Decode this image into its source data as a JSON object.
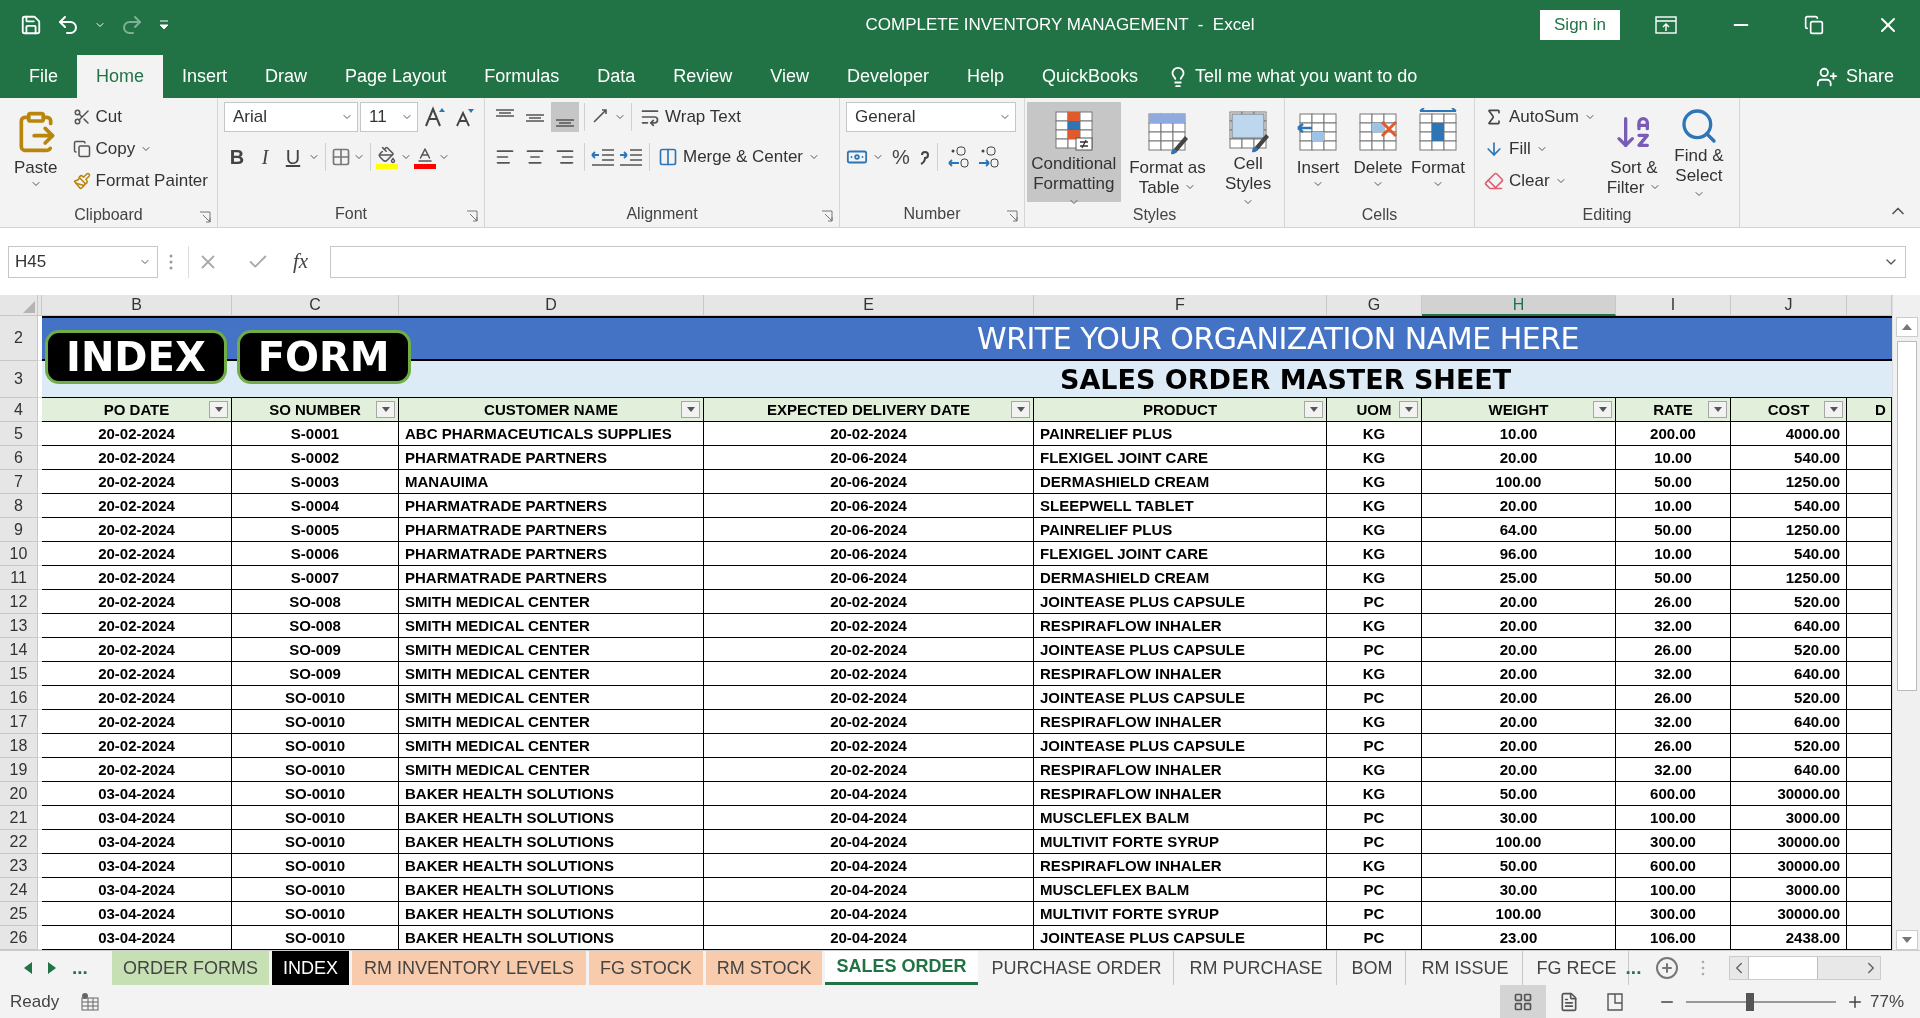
{
  "title_bar": {
    "title": "COMPLETE INVENTORY MANAGEMENT  -  Excel",
    "sign_in": "Sign in"
  },
  "menu": [
    {
      "label": "File",
      "selected": false
    },
    {
      "label": "Home",
      "selected": true
    },
    {
      "label": "Insert",
      "selected": false
    },
    {
      "label": "Draw",
      "selected": false
    },
    {
      "label": "Page Layout",
      "selected": false
    },
    {
      "label": "Formulas",
      "selected": false
    },
    {
      "label": "Data",
      "selected": false
    },
    {
      "label": "Review",
      "selected": false
    },
    {
      "label": "View",
      "selected": false
    },
    {
      "label": "Developer",
      "selected": false
    },
    {
      "label": "Help",
      "selected": false
    },
    {
      "label": "QuickBooks",
      "selected": false
    }
  ],
  "tell_me": "Tell me what you want to do",
  "share": "Share",
  "ribbon": {
    "clipboard": {
      "label": "Clipboard",
      "paste": "Paste",
      "cut": "Cut",
      "copy": "Copy",
      "format_painter": "Format Painter"
    },
    "font": {
      "label": "Font",
      "name": "Arial",
      "size": "11",
      "bold": "B",
      "italic": "I",
      "underline": "U"
    },
    "alignment": {
      "label": "Alignment",
      "vertical_align": [
        {
          "selected": false
        },
        {
          "selected": false
        },
        {
          "selected": true
        }
      ],
      "wrap_text": "Wrap Text",
      "merge_center": "Merge & Center"
    },
    "number": {
      "label": "Number",
      "format": "General",
      "percent": "%"
    },
    "styles": {
      "label": "Styles",
      "buttons": [
        {
          "label": "Conditional Formatting",
          "highlighted": true
        },
        {
          "label": "Format as Table",
          "highlighted": false
        },
        {
          "label": "Cell Styles",
          "highlighted": false
        }
      ]
    },
    "cells": {
      "label": "Cells",
      "buttons": [
        "Insert",
        "Delete",
        "Format"
      ]
    },
    "editing": {
      "label": "Editing",
      "autosum": "AutoSum",
      "fill": "Fill",
      "clear": "Clear",
      "sort_filter": "Sort & Filter",
      "find_select": "Find & Select"
    }
  },
  "formula_bar": {
    "name_box": "H45",
    "fx": "fx"
  },
  "column_headers": [
    {
      "label": "B",
      "selected": false
    },
    {
      "label": "C",
      "selected": false
    },
    {
      "label": "D",
      "selected": false
    },
    {
      "label": "E",
      "selected": false
    },
    {
      "label": "F",
      "selected": false
    },
    {
      "label": "G",
      "selected": false
    },
    {
      "label": "H",
      "selected": true
    },
    {
      "label": "I",
      "selected": false
    },
    {
      "label": "J",
      "selected": false
    }
  ],
  "sheet": {
    "banner_rows": [
      "2",
      "3"
    ],
    "nav_buttons": [
      "INDEX",
      "FORM"
    ],
    "org_name": "WRITE YOUR ORGANIZATION NAME HERE",
    "title": "SALES ORDER MASTER SHEET",
    "header_row": "4",
    "columns": [
      "PO DATE",
      "SO NUMBER",
      "CUSTOMER NAME",
      "EXPECTED DELIVERY DATE",
      "PRODUCT",
      "UOM",
      "WEIGHT",
      "RATE",
      "COST",
      "D"
    ],
    "rows": [
      {
        "n": "5",
        "cells": [
          "20-02-2024",
          "S-0001",
          "ABC PHARMACEUTICALS SUPPLIES",
          "20-02-2024",
          "PAINRELIEF PLUS",
          "KG",
          "10.00",
          "200.00",
          "4000.00"
        ]
      },
      {
        "n": "6",
        "cells": [
          "20-02-2024",
          "S-0002",
          "PHARMATRADE PARTNERS",
          "20-06-2024",
          "FLEXIGEL JOINT CARE",
          "KG",
          "20.00",
          "10.00",
          "540.00"
        ]
      },
      {
        "n": "7",
        "cells": [
          "20-02-2024",
          "S-0003",
          "MANAUIMA",
          "20-06-2024",
          "DERMASHIELD CREAM",
          "KG",
          "100.00",
          "50.00",
          "1250.00"
        ]
      },
      {
        "n": "8",
        "cells": [
          "20-02-2024",
          "S-0004",
          "PHARMATRADE PARTNERS",
          "20-06-2024",
          "SLEEPWELL TABLET",
          "KG",
          "20.00",
          "10.00",
          "540.00"
        ]
      },
      {
        "n": "9",
        "cells": [
          "20-02-2024",
          "S-0005",
          "PHARMATRADE PARTNERS",
          "20-06-2024",
          "PAINRELIEF PLUS",
          "KG",
          "64.00",
          "50.00",
          "1250.00"
        ]
      },
      {
        "n": "10",
        "cells": [
          "20-02-2024",
          "S-0006",
          "PHARMATRADE PARTNERS",
          "20-06-2024",
          "FLEXIGEL JOINT CARE",
          "KG",
          "96.00",
          "10.00",
          "540.00"
        ]
      },
      {
        "n": "11",
        "cells": [
          "20-02-2024",
          "S-0007",
          "PHARMATRADE PARTNERS",
          "20-06-2024",
          "DERMASHIELD CREAM",
          "KG",
          "25.00",
          "50.00",
          "1250.00"
        ]
      },
      {
        "n": "12",
        "cells": [
          "20-02-2024",
          "SO-008",
          "SMITH MEDICAL CENTER",
          "20-02-2024",
          "JOINTEASE PLUS CAPSULE",
          "PC",
          "20.00",
          "26.00",
          "520.00"
        ]
      },
      {
        "n": "13",
        "cells": [
          "20-02-2024",
          "SO-008",
          "SMITH MEDICAL CENTER",
          "20-02-2024",
          "RESPIRAFLOW INHALER",
          "KG",
          "20.00",
          "32.00",
          "640.00"
        ]
      },
      {
        "n": "14",
        "cells": [
          "20-02-2024",
          "SO-009",
          "SMITH MEDICAL CENTER",
          "20-02-2024",
          "JOINTEASE PLUS CAPSULE",
          "PC",
          "20.00",
          "26.00",
          "520.00"
        ]
      },
      {
        "n": "15",
        "cells": [
          "20-02-2024",
          "SO-009",
          "SMITH MEDICAL CENTER",
          "20-02-2024",
          "RESPIRAFLOW INHALER",
          "KG",
          "20.00",
          "32.00",
          "640.00"
        ]
      },
      {
        "n": "16",
        "cells": [
          "20-02-2024",
          "SO-0010",
          "SMITH MEDICAL CENTER",
          "20-02-2024",
          "JOINTEASE PLUS CAPSULE",
          "PC",
          "20.00",
          "26.00",
          "520.00"
        ]
      },
      {
        "n": "17",
        "cells": [
          "20-02-2024",
          "SO-0010",
          "SMITH MEDICAL CENTER",
          "20-02-2024",
          "RESPIRAFLOW INHALER",
          "KG",
          "20.00",
          "32.00",
          "640.00"
        ]
      },
      {
        "n": "18",
        "cells": [
          "20-02-2024",
          "SO-0010",
          "SMITH MEDICAL CENTER",
          "20-02-2024",
          "JOINTEASE PLUS CAPSULE",
          "PC",
          "20.00",
          "26.00",
          "520.00"
        ]
      },
      {
        "n": "19",
        "cells": [
          "20-02-2024",
          "SO-0010",
          "SMITH MEDICAL CENTER",
          "20-02-2024",
          "RESPIRAFLOW INHALER",
          "KG",
          "20.00",
          "32.00",
          "640.00"
        ]
      },
      {
        "n": "20",
        "cells": [
          "03-04-2024",
          "SO-0010",
          "BAKER HEALTH SOLUTIONS",
          "20-04-2024",
          "RESPIRAFLOW INHALER",
          "KG",
          "50.00",
          "600.00",
          "30000.00"
        ]
      },
      {
        "n": "21",
        "cells": [
          "03-04-2024",
          "SO-0010",
          "BAKER HEALTH SOLUTIONS",
          "20-04-2024",
          "MUSCLEFLEX BALM",
          "PC",
          "30.00",
          "100.00",
          "3000.00"
        ]
      },
      {
        "n": "22",
        "cells": [
          "03-04-2024",
          "SO-0010",
          "BAKER HEALTH SOLUTIONS",
          "20-04-2024",
          "MULTIVIT FORTE SYRUP",
          "PC",
          "100.00",
          "300.00",
          "30000.00"
        ]
      },
      {
        "n": "23",
        "cells": [
          "03-04-2024",
          "SO-0010",
          "BAKER HEALTH SOLUTIONS",
          "20-04-2024",
          "RESPIRAFLOW INHALER",
          "KG",
          "50.00",
          "600.00",
          "30000.00"
        ]
      },
      {
        "n": "24",
        "cells": [
          "03-04-2024",
          "SO-0010",
          "BAKER HEALTH SOLUTIONS",
          "20-04-2024",
          "MUSCLEFLEX BALM",
          "PC",
          "30.00",
          "100.00",
          "3000.00"
        ]
      },
      {
        "n": "25",
        "cells": [
          "03-04-2024",
          "SO-0010",
          "BAKER HEALTH SOLUTIONS",
          "20-04-2024",
          "MULTIVIT FORTE SYRUP",
          "PC",
          "100.00",
          "300.00",
          "30000.00"
        ]
      },
      {
        "n": "26",
        "cells": [
          "03-04-2024",
          "SO-0010",
          "BAKER HEALTH SOLUTIONS",
          "20-04-2024",
          "JOINTEASE PLUS CAPSULE",
          "PC",
          "23.00",
          "106.00",
          "2438.00"
        ]
      }
    ]
  },
  "sheet_nav_more": "...",
  "sheet_tabs": [
    {
      "label": "ORDER FORMS",
      "selected": false,
      "color": "#c6e0b4"
    },
    {
      "label": "INDEX",
      "selected": false,
      "color": "#000000"
    },
    {
      "label": "RM INVENTORY LEVELS",
      "selected": false,
      "color": "#f8cbad"
    },
    {
      "label": "FG STOCK",
      "selected": false,
      "color": "#f8cbad"
    },
    {
      "label": "RM STOCK",
      "selected": false,
      "color": "#f8cbad"
    },
    {
      "label": "SALES ORDER",
      "selected": true
    },
    {
      "label": "PURCHASE ORDER",
      "selected": false
    },
    {
      "label": "RM PURCHASE",
      "selected": false
    },
    {
      "label": "BOM",
      "selected": false
    },
    {
      "label": "RM ISSUE",
      "selected": false
    },
    {
      "label": "FG RECE",
      "selected": false
    }
  ],
  "more_tabs": "...",
  "status_bar": {
    "ready": "Ready",
    "views": [
      {
        "selected": true
      },
      {
        "selected": false
      },
      {
        "selected": false
      }
    ],
    "zoom": {
      "label": "77%",
      "level": 0.43
    }
  }
}
